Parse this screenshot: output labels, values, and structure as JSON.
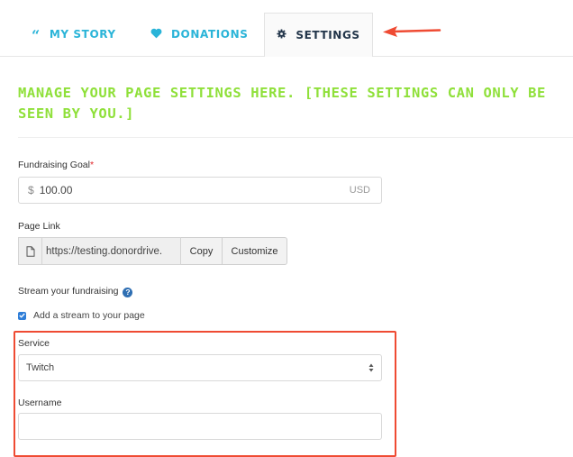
{
  "tabs": [
    {
      "label": "MY STORY",
      "icon": "quote-icon"
    },
    {
      "label": "DONATIONS",
      "icon": "heart-icon"
    },
    {
      "label": "SETTINGS",
      "icon": "gear-icon",
      "active": true
    }
  ],
  "heading": "MANAGE YOUR PAGE SETTINGS HERE. [THESE SETTINGS CAN ONLY BE SEEN BY YOU.]",
  "goal": {
    "label": "Fundraising Goal",
    "required_mark": "*",
    "currency": "$",
    "value": "100.00",
    "unit": "USD"
  },
  "page_link": {
    "label": "Page Link",
    "value": "https://testing.donordrive.",
    "copy_label": "Copy",
    "customize_label": "Customize"
  },
  "stream": {
    "label": "Stream your fundraising",
    "checkbox_label": "Add a stream to your page",
    "checked": true
  },
  "service": {
    "label": "Service",
    "selected": "Twitch"
  },
  "username": {
    "label": "Username",
    "value": ""
  },
  "colors": {
    "accent": "#2ab4d8",
    "heading": "#8fe03a",
    "highlight": "#ef4b33",
    "arrow": "#ef4b33"
  }
}
